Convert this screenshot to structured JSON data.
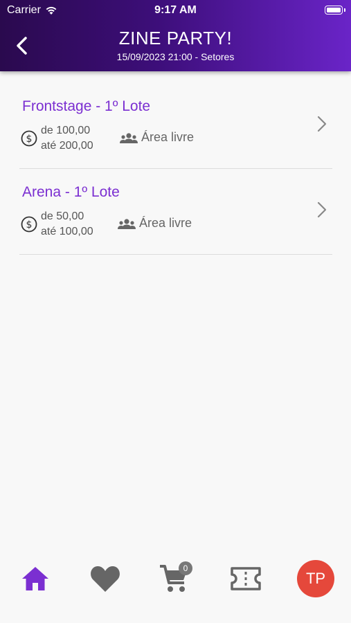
{
  "status_bar": {
    "carrier": "Carrier",
    "time": "9:17 AM"
  },
  "header": {
    "title": "ZINE PARTY!",
    "subtitle": "15/09/2023 21:00 - Setores"
  },
  "sectors": [
    {
      "name": "Frontstage - 1º Lote",
      "price_from": "de 100,00",
      "price_to": "até 200,00",
      "area": "Área livre"
    },
    {
      "name": "Arena - 1º Lote",
      "price_from": "de 50,00",
      "price_to": "até 100,00",
      "area": "Área livre"
    }
  ],
  "tabbar": {
    "cart_count": "0",
    "avatar_initials": "TP",
    "active_tab": "home",
    "active_color": "#7b2fd1",
    "inactive_color": "#666666"
  },
  "colors": {
    "accent": "#7b2fd1",
    "header_start": "#2a0a4e",
    "header_end": "#6a24c8",
    "avatar": "#e5483b"
  },
  "icons": [
    "back-arrow-icon",
    "wifi-icon",
    "battery-icon",
    "dollar-circle-icon",
    "people-group-icon",
    "chevron-right-icon",
    "home-icon",
    "heart-icon",
    "cart-icon",
    "ticket-icon"
  ]
}
